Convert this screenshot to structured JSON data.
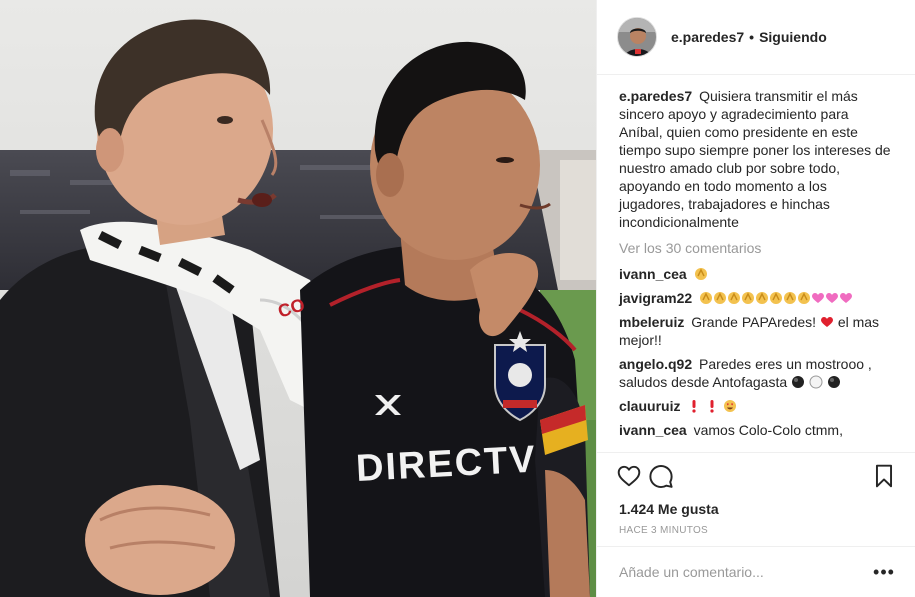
{
  "post": {
    "photo": {
      "jersey_sponsor": "DIRECTV",
      "scarf_text": "CO"
    },
    "header": {
      "username": "e.paredes7",
      "separator": "•",
      "follow_status": "Siguiendo"
    },
    "caption": {
      "username": "e.paredes7",
      "text": "Quisiera transmitir el más sincero apoyo y agradecimiento para Aníbal, quien como presidente en este tiempo supo siempre poner los intereses de nuestro amado club por sobre todo, apoyando en todo momento a los jugadores, trabajadores e hinchas incondicionalmente"
    },
    "view_comments": "Ver los 30 comentarios",
    "comments": [
      {
        "username": "ivann_cea",
        "text": "",
        "emojis": [
          "clap"
        ]
      },
      {
        "username": "javigram22",
        "text": "",
        "emojis": [
          "clap",
          "clap",
          "clap",
          "clap",
          "clap",
          "clap",
          "clap",
          "clap",
          "heart-pink",
          "heart-pink",
          "heart-pink"
        ]
      },
      {
        "username": "mbeleruiz",
        "text": "Grande PAPAredes!",
        "emojis_after_index": 17,
        "tail": "el mas mejor!!",
        "emojis": [
          "heart-red"
        ]
      },
      {
        "username": "angelo.q92",
        "text": "Paredes eres un mostrooo , saludos desde Antofagasta",
        "emojis": [
          "ball-black",
          "ball-white",
          "ball-black"
        ]
      },
      {
        "username": "clauuruiz",
        "text": "",
        "emojis": [
          "exclaim",
          "exclaim",
          "smile-hearts"
        ]
      },
      {
        "username": "ivann_cea",
        "text": "vamos Colo-Colo ctmm,",
        "emojis": []
      }
    ],
    "likes": "1.424 Me gusta",
    "timestamp": "HACE 3 MINUTOS",
    "add_comment": {
      "placeholder": "Añade un comentario..."
    },
    "options_label": "•••",
    "colors": {
      "text": "#262626",
      "muted": "#999999",
      "border": "#efefef",
      "heart_red": "#ed4956"
    },
    "icons": [
      "heart-icon",
      "comment-icon",
      "bookmark-icon",
      "more-options-icon"
    ]
  }
}
